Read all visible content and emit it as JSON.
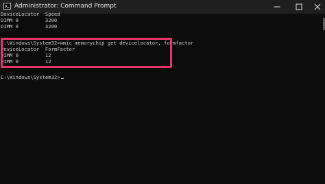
{
  "window": {
    "title": "Administrator: Command Prompt",
    "icon": "cmd-icon"
  },
  "controls": {
    "minimize": "minimize-icon",
    "maximize": "maximize-icon",
    "close": "close-icon"
  },
  "console": {
    "lines": [
      "DeviceLocator  Speed",
      "DIMM 0         3200",
      "DIMM 0         3200",
      "",
      "C:\\Windows\\System32>wmic memorychip get devicelocator, formfactor",
      "DeviceLocator  FormFactor",
      "DIMM 0         12",
      "DIMM 0         12",
      "",
      "",
      "C:\\Windows\\System32>"
    ],
    "highlight_color": "#e8336a",
    "text_color": "#cccccc",
    "background_color": "#0c0c0c"
  }
}
